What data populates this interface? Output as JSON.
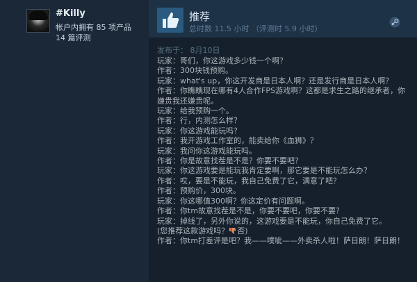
{
  "reviewer": {
    "name": "#Killy",
    "products_owned": "帐户内拥有 85 项产品",
    "reviews_count": "14 篇评测"
  },
  "review": {
    "verdict": "推荐",
    "hours": "总时数 11.5 小时 （评测时 5.9 小时）",
    "posted": "发布于：  8月10日",
    "lines": [
      "玩家：哥们，你这游戏多少钱一个啊？",
      "作者：300块钱预购。",
      "玩家：what's up，你这开发商是日本人啊？还是发行商是日本人啊？",
      "作者：你瞧瞧现在哪有4人合作FPS游戏啊？这都是求生之路的继承者，你嫌贵我还嫌贵呢。",
      "玩家：给我预购一个。",
      "作者：行，内测怎么样？",
      "玩家：你这游戏能玩吗？",
      "作者：我开游戏工作室的，能卖给你《血狮》？",
      "玩家：我问你这游戏能玩吗。",
      "作者：你是故意找茬是不是？你要不要吧？",
      "玩家：你这游戏要是能玩我肯定要啊，那它要是不能玩怎么办？",
      "作者：哎，要是不能玩，我自己免费了它，满意了吧？",
      "作者：预购价，300块。",
      "玩家：你这哪值300啊？你这定价有问题啊。",
      "作者：你tm故意找茬是不是，你要不要吧，你要不要？",
      "玩家：掉线了，另外你说的，这游戏要是不能玩，你自己免费了它。",
      "作者：你tm打差评是吧？我——噗呲——外卖杀人啦！萨日朗！萨日朗！"
    ],
    "helpful_prefix": "(您推荐这款游戏吗？",
    "helpful_suffix": "否)"
  },
  "icons": {
    "recommend": "thumbs-up-icon",
    "platform": "steam-icon",
    "vote_no": "thumbs-down-icon"
  },
  "colors": {
    "header_bg": "#1e3246",
    "thumb_bg": "#2a5a80",
    "text": "#acb2b8",
    "muted": "#5d7b94",
    "vote_icon": "#e38a58"
  }
}
